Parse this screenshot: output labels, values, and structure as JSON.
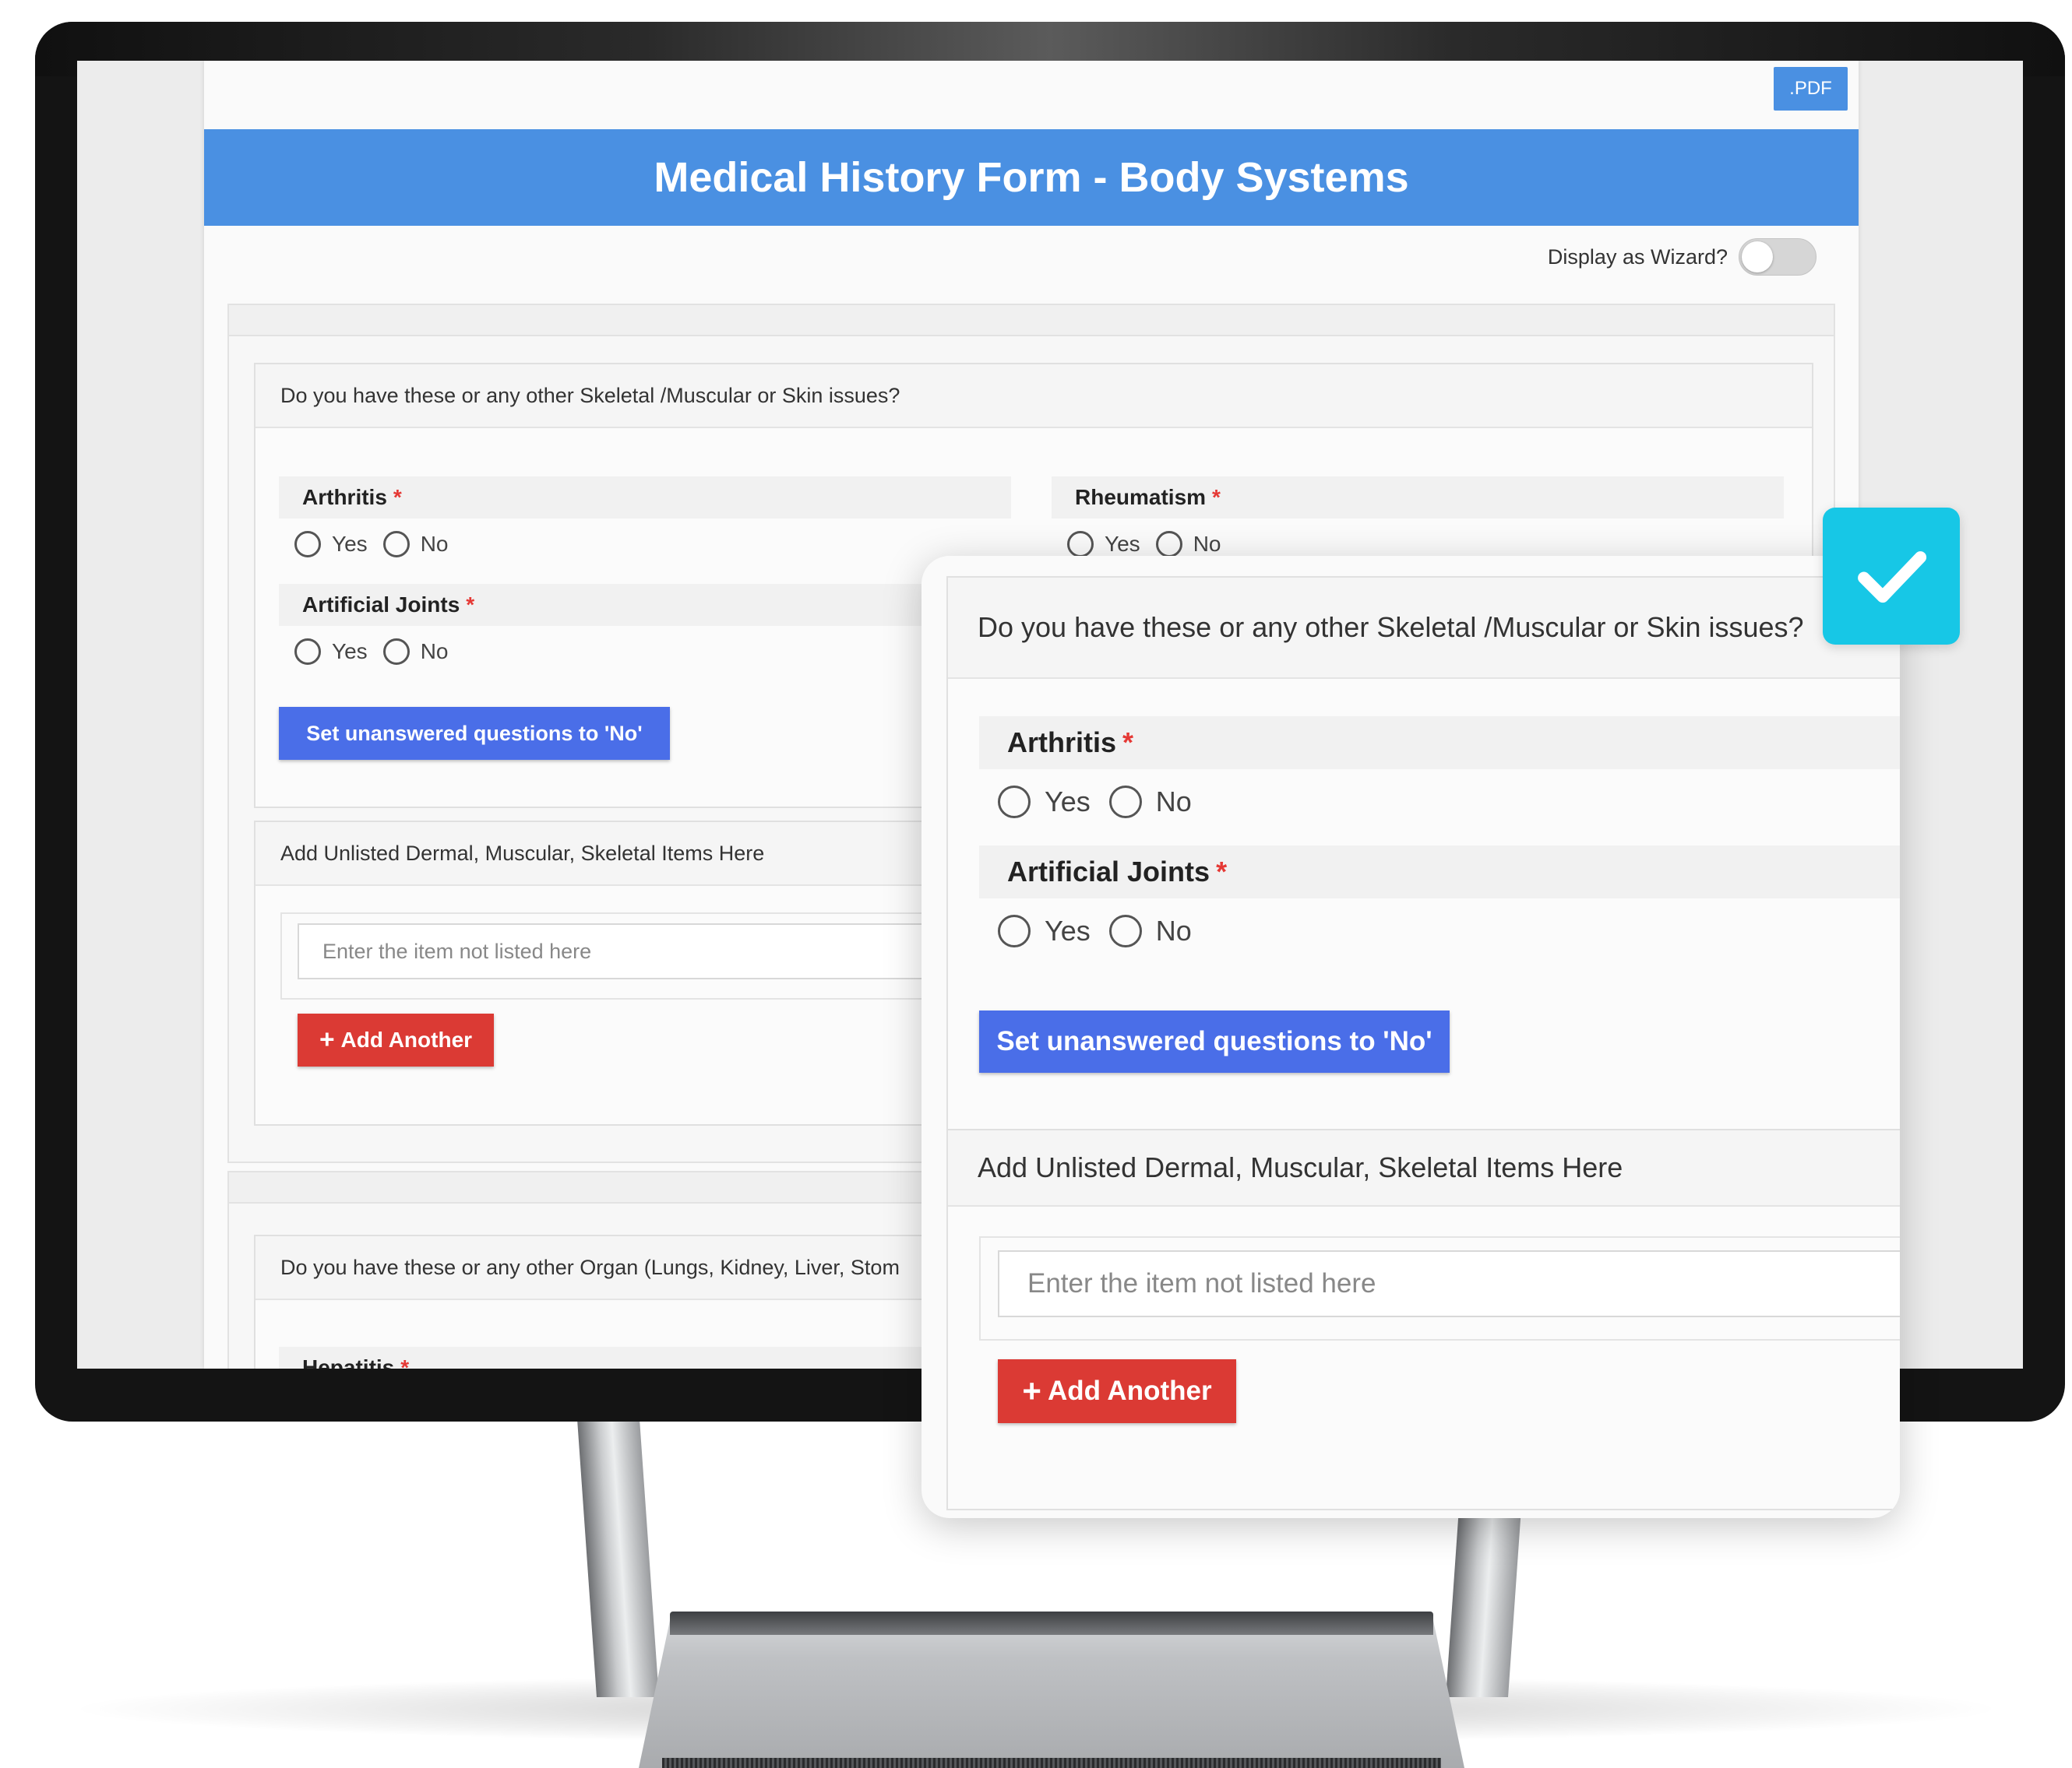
{
  "form": {
    "pdf_button": ".PDF",
    "title": "Medical History Form - Body Systems",
    "wizard_label": "Display as Wizard?",
    "wizard_enabled": false
  },
  "skeletal_section": {
    "question": "Do you have these or any other Skeletal /Muscular or Skin issues?",
    "items": [
      {
        "label": "Arthritis",
        "required_mark": "*",
        "options": [
          "Yes",
          "No"
        ],
        "selected": null
      },
      {
        "label": "Rheumatism",
        "required_mark": "*",
        "options": [
          "Yes",
          "No"
        ],
        "selected": null
      },
      {
        "label": "Artificial Joints",
        "required_mark": "*",
        "options": [
          "Yes",
          "No"
        ],
        "selected": null
      }
    ],
    "set_no_button": "Set unanswered questions to 'No'"
  },
  "unlisted_section": {
    "header": "Add Unlisted Dermal, Muscular, Skeletal Items Here",
    "input_placeholder": "Enter the item not listed here",
    "add_button": "Add Another"
  },
  "organ_section": {
    "question": "Do you have these or any other Organ (Lungs, Kidney, Liver, Stom",
    "first_item": "Hepatitis",
    "required_mark": "*"
  },
  "colors": {
    "title_bar": "#4a90e2",
    "primary_button": "#4a6ee8",
    "add_button": "#db3a34",
    "required": "#e53935",
    "check_badge": "#17c7e6"
  },
  "icons": {
    "badge": "check-icon",
    "add": "plus-icon"
  }
}
